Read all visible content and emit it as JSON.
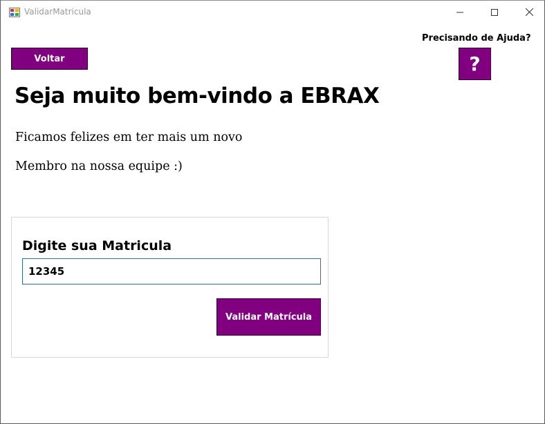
{
  "window": {
    "title": "ValidarMatricula",
    "controls": {
      "minimize": "minimize-icon",
      "maximize": "maximize-icon",
      "close": "close-icon"
    }
  },
  "toolbar": {
    "back_label": "Voltar",
    "help_label": "Precisando de Ajuda?",
    "help_button_label": "?"
  },
  "welcome": {
    "title": "Seja muito bem-vindo a EBRAX",
    "line1": "Ficamos felizes em ter mais um novo",
    "line2": "Membro na nossa equipe :)"
  },
  "form": {
    "label": "Digite sua Matricula",
    "matricula_value": "12345",
    "submit_label": "Validar Matrícula"
  },
  "colors": {
    "accent": "#800080",
    "input_border": "#2e6da4"
  }
}
